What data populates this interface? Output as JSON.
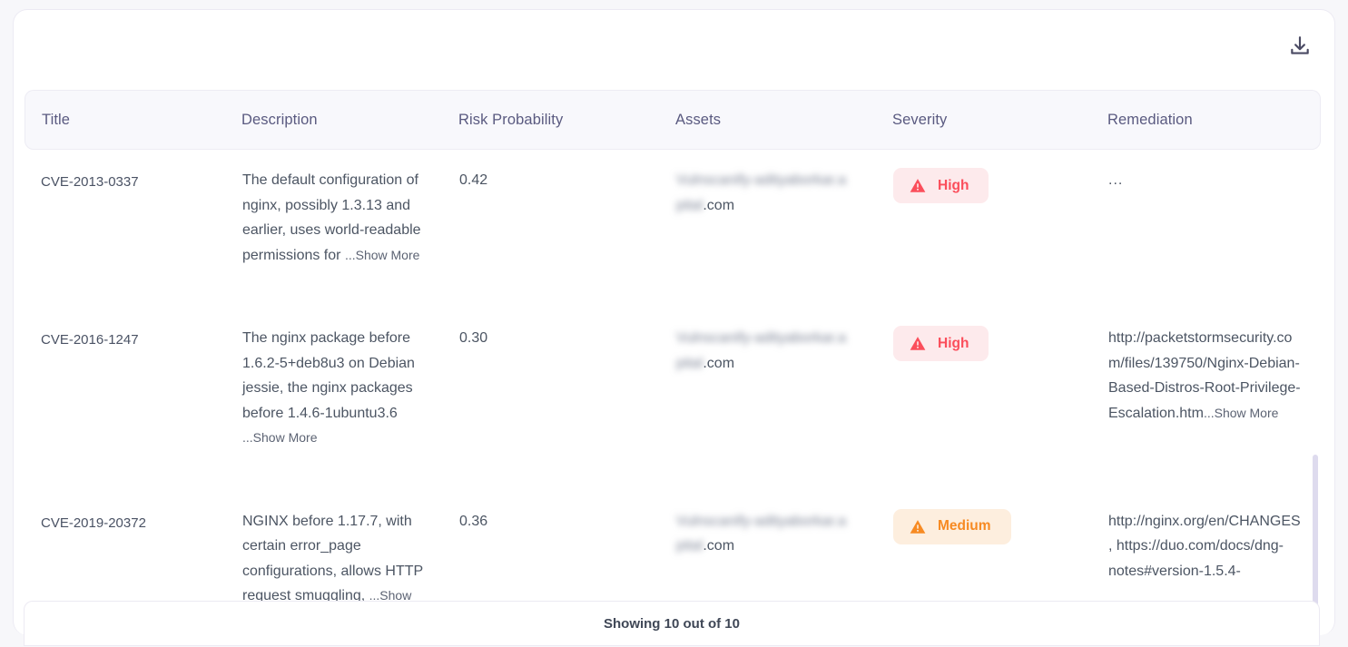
{
  "toolbar": {
    "download_label": "Download",
    "download_icon": "download-icon"
  },
  "table": {
    "columns": [
      {
        "key": "title",
        "label": "Title"
      },
      {
        "key": "description",
        "label": "Description"
      },
      {
        "key": "risk",
        "label": "Risk Probability"
      },
      {
        "key": "assets",
        "label": "Assets"
      },
      {
        "key": "severity",
        "label": "Severity"
      },
      {
        "key": "remediation",
        "label": "Remediation"
      }
    ],
    "show_more_label": "...Show More",
    "rows": [
      {
        "title": "CVE-2013-0337",
        "description": "The default configuration of nginx, possibly 1.3.13 and earlier, uses world-readable permissions for",
        "description_truncated": true,
        "risk": "0.42",
        "asset_redacted": "Vulnscanify-adityaborkar.a",
        "asset_redacted_2": "pital",
        "asset_suffix": ".com",
        "severity": "High",
        "severity_level": "high",
        "remediation": "...",
        "remediation_truncated": false
      },
      {
        "title": "CVE-2016-1247",
        "description": "The nginx package before 1.6.2-5+deb8u3 on Debian jessie, the nginx packages before 1.4.6-1ubuntu3.6",
        "description_truncated": true,
        "risk": "0.30",
        "asset_redacted": "Vulnscanify-adityaborkar.a",
        "asset_redacted_2": "pital",
        "asset_suffix": ".com",
        "severity": "High",
        "severity_level": "high",
        "remediation": "http://packetstormsecurity.com/files/139750/Nginx-Debian-Based-Distros-Root-Privilege-Escalation.htm",
        "remediation_truncated": true
      },
      {
        "title": "CVE-2019-20372",
        "description": "NGINX before 1.17.7, with certain error_page configurations, allows HTTP request smuggling,",
        "description_truncated": true,
        "risk": "0.36",
        "asset_redacted": "Vulnscanify-adityaborkar.a",
        "asset_redacted_2": "pital",
        "asset_suffix": ".com",
        "severity": "Medium",
        "severity_level": "medium",
        "remediation": "http://nginx.org/en/CHANGES, https://duo.com/docs/dng-notes#version-1.5.4-",
        "remediation_truncated": false
      }
    ]
  },
  "footer": {
    "status": "Showing 10 out of 10"
  },
  "colors": {
    "high_bg": "#fdeaec",
    "high_fg": "#fb4e5b",
    "medium_bg": "#fdeede",
    "medium_fg": "#f78a22",
    "header_bg": "#f8f8fc",
    "header_fg": "#5a5a80",
    "body_fg": "#4c5563",
    "scrollbar": "#dedbee"
  }
}
